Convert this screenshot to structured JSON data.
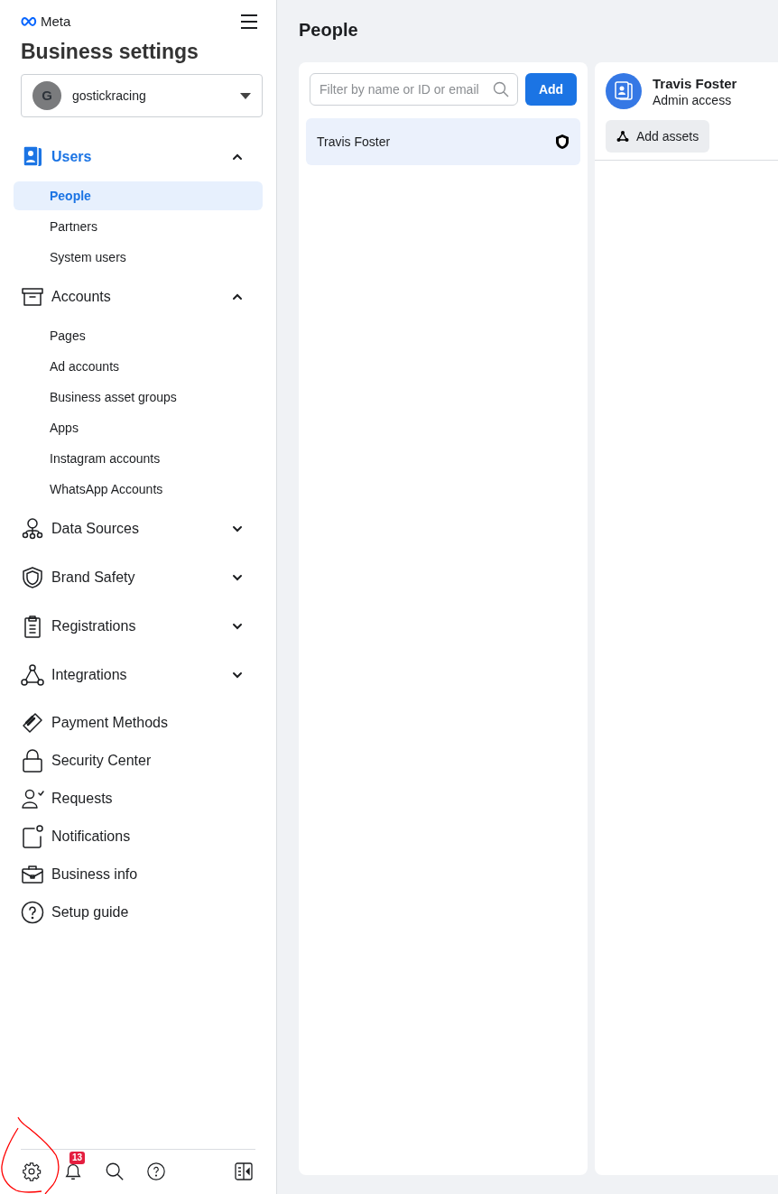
{
  "brand": "Meta",
  "title": "Business settings",
  "account": {
    "initial": "G",
    "name": "gostickracing"
  },
  "nav": [
    {
      "kind": "group",
      "label": "Users",
      "expanded": true,
      "selected": true,
      "children": [
        {
          "label": "People",
          "selected": true
        },
        {
          "label": "Partners",
          "selected": false
        },
        {
          "label": "System users",
          "selected": false
        }
      ]
    },
    {
      "kind": "group",
      "label": "Accounts",
      "expanded": true,
      "selected": false,
      "children": [
        {
          "label": "Pages",
          "selected": false
        },
        {
          "label": "Ad accounts",
          "selected": false
        },
        {
          "label": "Business asset groups",
          "selected": false
        },
        {
          "label": "Apps",
          "selected": false
        },
        {
          "label": "Instagram accounts",
          "selected": false
        },
        {
          "label": "WhatsApp Accounts",
          "selected": false
        }
      ]
    },
    {
      "kind": "group",
      "label": "Data Sources",
      "expanded": false,
      "selected": false
    },
    {
      "kind": "group",
      "label": "Brand Safety",
      "expanded": false,
      "selected": false
    },
    {
      "kind": "group",
      "label": "Registrations",
      "expanded": false,
      "selected": false
    },
    {
      "kind": "group",
      "label": "Integrations",
      "expanded": false,
      "selected": false
    },
    {
      "kind": "link",
      "label": "Payment Methods"
    },
    {
      "kind": "link",
      "label": "Security Center"
    },
    {
      "kind": "link",
      "label": "Requests"
    },
    {
      "kind": "link",
      "label": "Notifications"
    },
    {
      "kind": "link",
      "label": "Business info"
    },
    {
      "kind": "link",
      "label": "Setup guide"
    }
  ],
  "footer": {
    "notification_count": "13"
  },
  "page_title": "People",
  "search": {
    "placeholder": "Filter by name or ID or email"
  },
  "add_button": "Add",
  "people": [
    {
      "name": "Travis Foster",
      "selected": true,
      "admin": true
    }
  ],
  "detail": {
    "name": "Travis Foster",
    "role": "Admin access",
    "action": "Add assets"
  }
}
